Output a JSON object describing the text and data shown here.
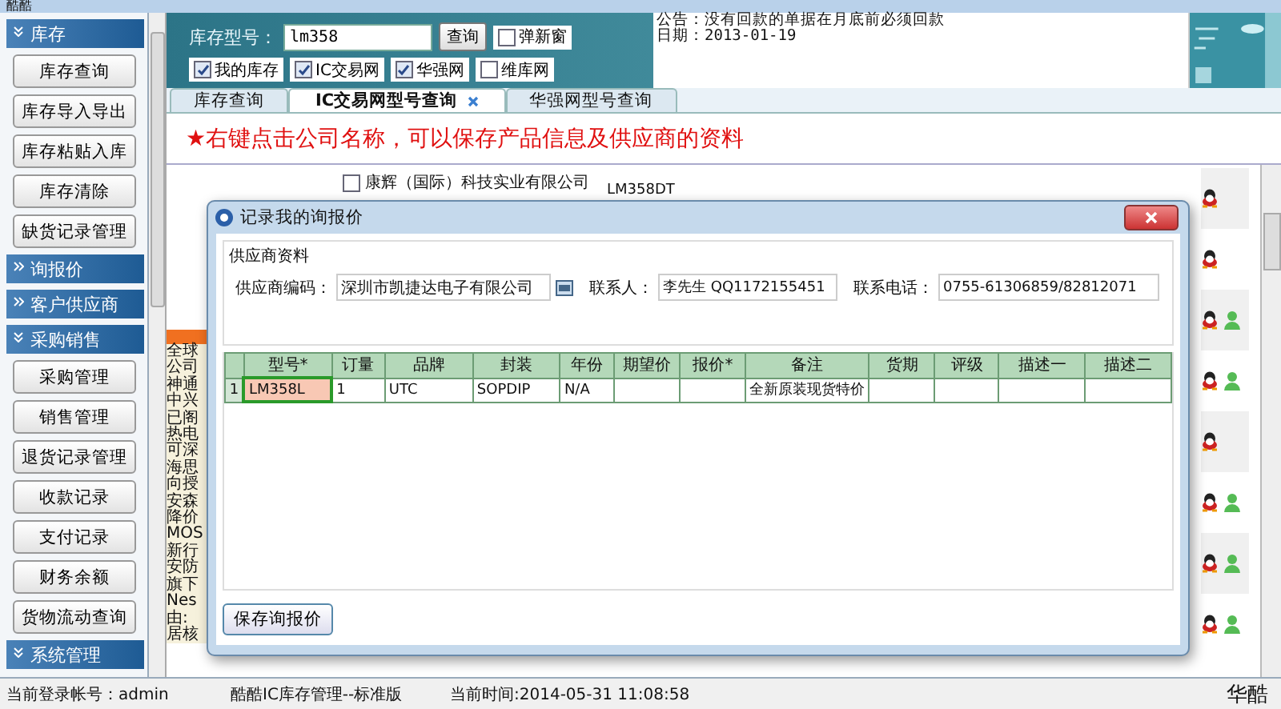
{
  "window": {
    "title": "酷酷"
  },
  "sidebar": {
    "sections": [
      {
        "label": "库存",
        "expanded": true,
        "items": [
          "库存查询",
          "库存导入导出",
          "库存粘贴入库",
          "库存清除",
          "缺货记录管理"
        ]
      },
      {
        "label": "询报价",
        "expanded": false
      },
      {
        "label": "客户供应商",
        "expanded": false
      },
      {
        "label": "采购销售",
        "expanded": true,
        "items": [
          "采购管理",
          "销售管理",
          "退货记录管理",
          "收款记录",
          "支付记录",
          "财务余额",
          "货物流动查询"
        ]
      },
      {
        "label": "系统管理",
        "expanded": true
      }
    ]
  },
  "search": {
    "label": "库存型号：",
    "value": "lm358",
    "button": "查询",
    "popup": {
      "label": "弹新窗",
      "checked": false
    }
  },
  "sources": [
    {
      "label": "我的库存",
      "checked": true
    },
    {
      "label": "IC交易网",
      "checked": true
    },
    {
      "label": "华强网",
      "checked": true
    },
    {
      "label": "维库网",
      "checked": false
    }
  ],
  "notice": {
    "lines": [
      "公告：没有回款的单据在月底前必须回款",
      "日期：2013-01-19"
    ]
  },
  "tabs": [
    {
      "label": "库存查询",
      "selected": false
    },
    {
      "label": "IC交易网型号查询",
      "selected": true
    },
    {
      "label": "华强网型号查询",
      "selected": false
    }
  ],
  "hint": "★右键点击公司名称，可以保存产品信息及供应商的资料",
  "results": {
    "company": {
      "label": "康辉（国际）科技实业有限公司",
      "checked": false
    },
    "part": "LM358DT",
    "news_fragments": [
      "全球",
      "公司",
      "神通",
      "中兴",
      "已阁",
      "热电",
      "可深",
      "海思",
      "向授",
      "安森",
      "降价",
      "MOS",
      "新行",
      "安防",
      "旗下",
      "Nes",
      "由:",
      "居核"
    ],
    "contacts": [
      {
        "user": false
      },
      {
        "user": false
      },
      {
        "user": true
      },
      {
        "user": true
      },
      {
        "user": false
      },
      {
        "user": true
      },
      {
        "user": true
      },
      {
        "user": true
      }
    ]
  },
  "dialog": {
    "title": "记录我的询报价",
    "group": "供应商资料",
    "fields": [
      {
        "label": "供应商编码：",
        "value": "深圳市凯捷达电子有限公司",
        "kind": "lookup"
      },
      {
        "label": "联系人：",
        "value": "李先生 QQ1172155451",
        "kind": "text"
      },
      {
        "label": "联系电话：",
        "value": "0755-61306859/82812071",
        "kind": "text"
      }
    ],
    "grid": {
      "columns": [
        "型号*",
        "订量",
        "品牌",
        "封装",
        "年份",
        "期望价",
        "报价*",
        "备注",
        "货期",
        "评级",
        "描述一",
        "描述二"
      ],
      "rows": [
        {
          "number": "1",
          "selected": true,
          "cells": [
            "LM358L",
            "1",
            "UTC",
            "SOPDIP",
            "N/A",
            "",
            "",
            "全新原装现货特价",
            "",
            "",
            "",
            ""
          ]
        }
      ]
    },
    "save_button": "保存询报价"
  },
  "status_bar": {
    "account": "当前登录帐号：admin",
    "product": "酷酷IC库存管理--标准版",
    "time": "当前时间:2014-05-31 11:08:58",
    "brand": "华酷"
  }
}
